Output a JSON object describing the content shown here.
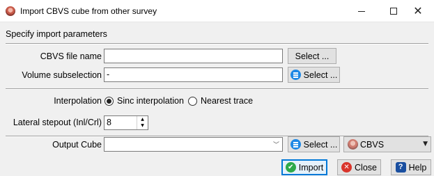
{
  "window": {
    "title": "Import CBVS cube from other survey",
    "icon": "opendtect-cube-icon",
    "controls": {
      "minimize": "minimize-icon",
      "maximize": "maximize-icon",
      "close": "close-icon"
    }
  },
  "header": {
    "label": "Specify import parameters"
  },
  "file_row": {
    "label": "CBVS file name",
    "value": "",
    "button": "Select ..."
  },
  "subsel_row": {
    "label": "Volume subselection",
    "value": "-",
    "button": "Select ..."
  },
  "interp_row": {
    "label": "Interpolation",
    "options": [
      {
        "label": "Sinc interpolation",
        "checked": true
      },
      {
        "label": "Nearest trace",
        "checked": false
      }
    ]
  },
  "stepout_row": {
    "label": "Lateral stepout (Inl/Crl)",
    "value": "8"
  },
  "output_row": {
    "label": "Output Cube",
    "value": "",
    "button": "Select ...",
    "format": "CBVS"
  },
  "buttons": {
    "import": "Import",
    "close": "Close",
    "help": "Help"
  },
  "colors": {
    "accent": "#0078d7",
    "window_bg": "#f0f0f0"
  }
}
